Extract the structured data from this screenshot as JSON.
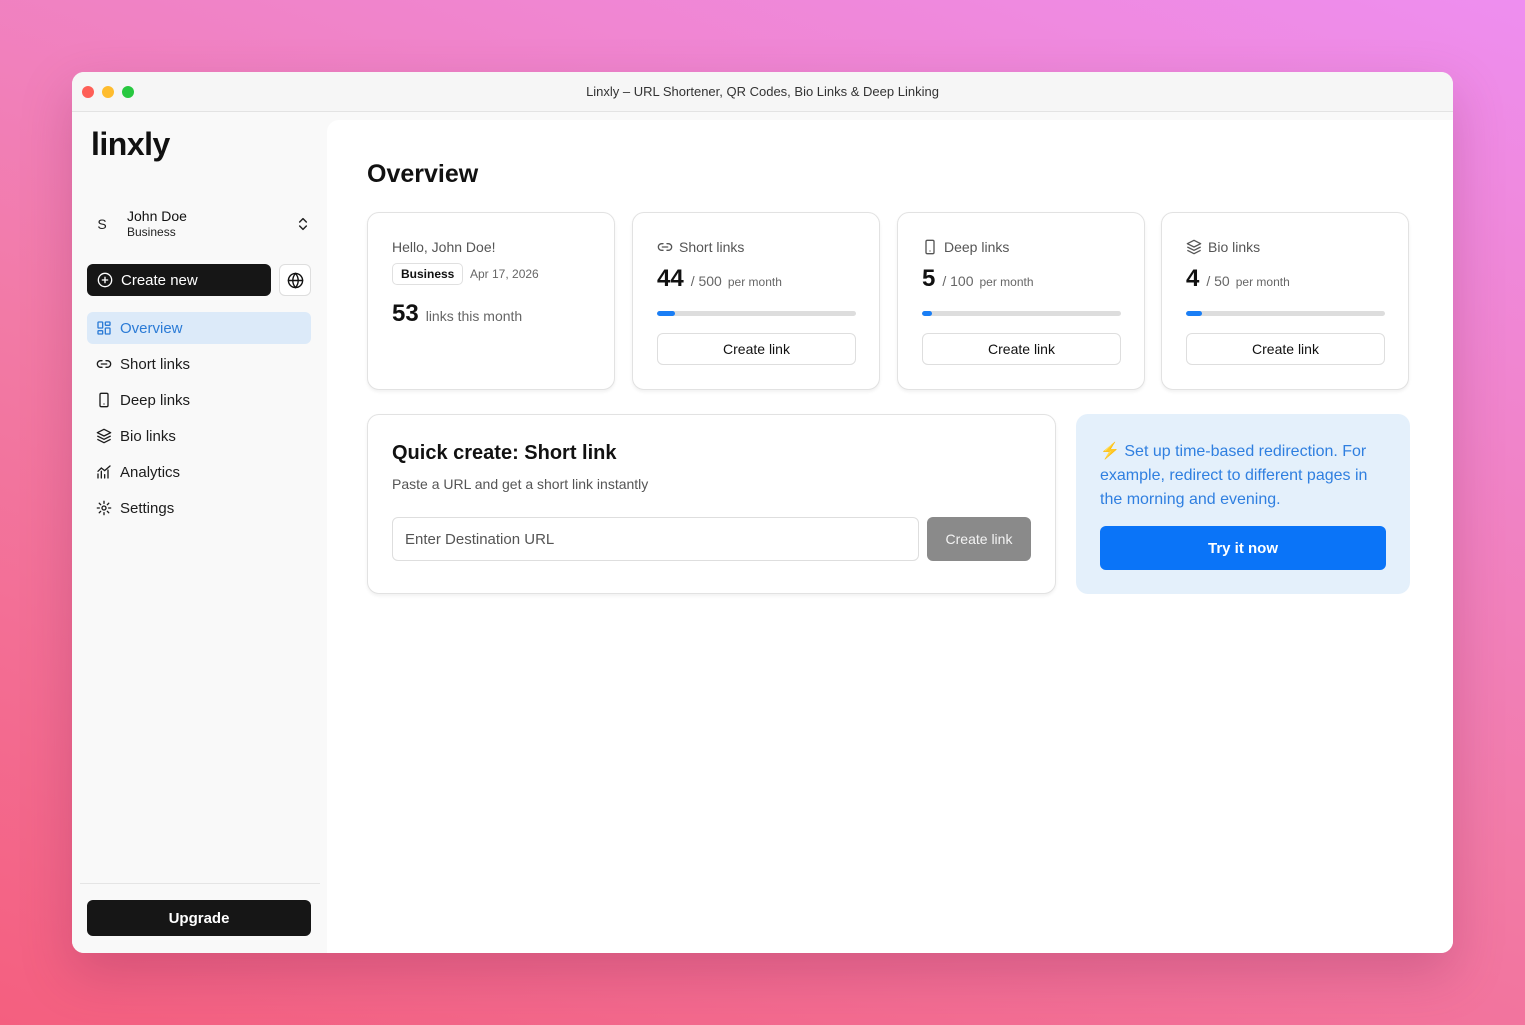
{
  "window": {
    "title": "Linxly – URL Shortener, QR Codes, Bio Links & Deep Linking"
  },
  "sidebar": {
    "logo": "linxly",
    "account": {
      "initial": "S",
      "name": "John Doe",
      "plan": "Business"
    },
    "create_new_label": "Create new",
    "nav": [
      {
        "label": "Overview",
        "icon": "layout-grid-icon",
        "active": true
      },
      {
        "label": "Short links",
        "icon": "link-icon",
        "active": false
      },
      {
        "label": "Deep links",
        "icon": "smartphone-icon",
        "active": false
      },
      {
        "label": "Bio links",
        "icon": "layers-icon",
        "active": false
      },
      {
        "label": "Analytics",
        "icon": "chart-line-icon",
        "active": false
      },
      {
        "label": "Settings",
        "icon": "gear-icon",
        "active": false
      }
    ],
    "upgrade_label": "Upgrade"
  },
  "main": {
    "title": "Overview",
    "welcome": {
      "greeting": "Hello, John Doe!",
      "badge": "Business",
      "date": "Apr 17, 2026",
      "count": "53",
      "count_label": "links this month"
    },
    "stats": [
      {
        "title": "Short links",
        "icon": "link-icon",
        "used": "44",
        "limit": "/ 500",
        "period": "per month",
        "progress": 0.088,
        "button": "Create link"
      },
      {
        "title": "Deep links",
        "icon": "smartphone-icon",
        "used": "5",
        "limit": "/ 100",
        "period": "per month",
        "progress": 0.05,
        "button": "Create link"
      },
      {
        "title": "Bio links",
        "icon": "layers-icon",
        "used": "4",
        "limit": "/ 50",
        "period": "per month",
        "progress": 0.08,
        "button": "Create link"
      }
    ],
    "quick_create": {
      "title": "Quick create: Short link",
      "subtitle": "Paste a URL and get a short link instantly",
      "placeholder": "Enter Destination URL",
      "button": "Create link"
    },
    "promo": {
      "text": "⚡ Set up time-based redirection. For example, redirect to different pages in the morning and evening.",
      "button": "Try it now"
    }
  },
  "colors": {
    "accent": "#1a7ef5",
    "active_nav_bg": "#dceaf9",
    "promo_bg": "#e4f0fb",
    "dark_button": "#161616"
  }
}
